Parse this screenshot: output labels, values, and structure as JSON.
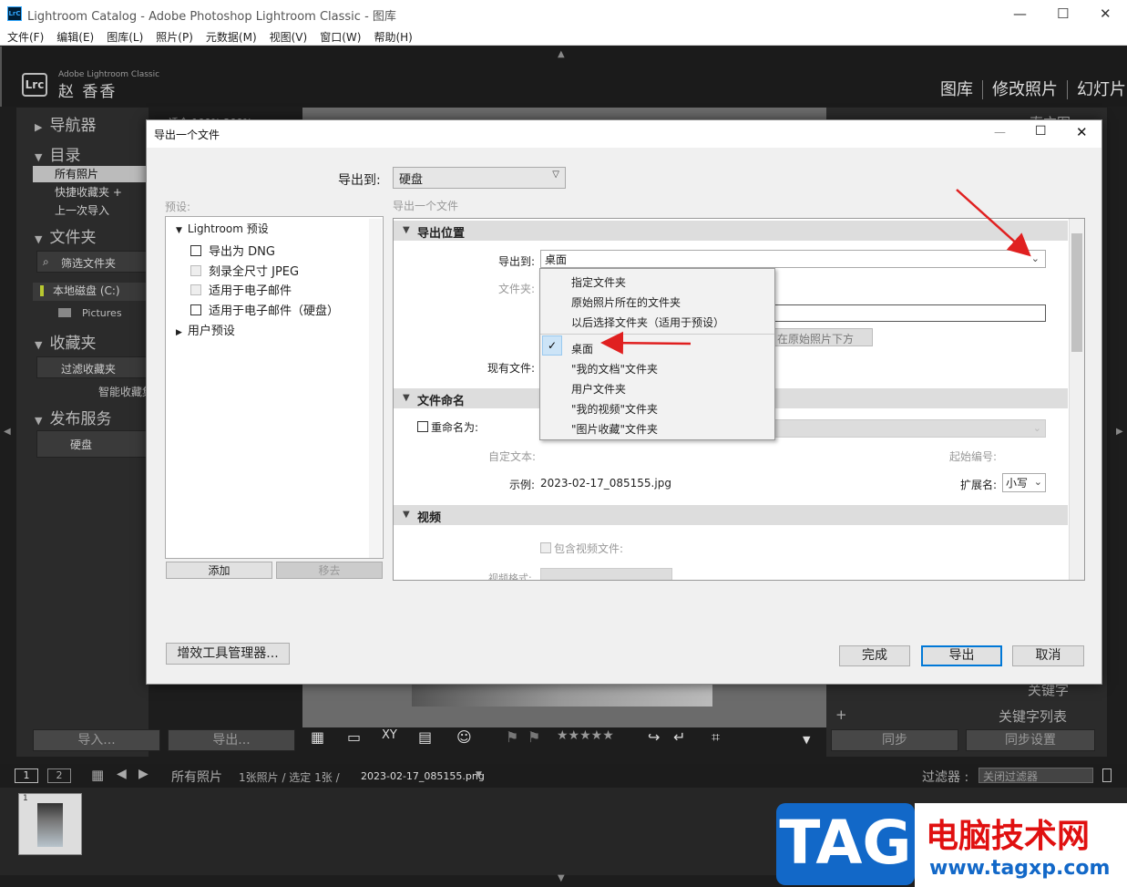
{
  "window": {
    "title": "Lightroom Catalog - Adobe Photoshop Lightroom Classic - 图库",
    "logo": "LrC"
  },
  "menu": [
    "文件(F)",
    "编辑(E)",
    "图库(L)",
    "照片(P)",
    "元数据(M)",
    "视图(V)",
    "窗口(W)",
    "帮助(H)"
  ],
  "lr": {
    "brand": "Adobe Lightroom Classic",
    "user": "赵 香香",
    "logo": "Lrc",
    "modules": [
      "图库",
      "修改照片",
      "幻灯片"
    ],
    "left": {
      "navigator": "导航器",
      "navigator_zoom": "适合  100%  200%",
      "catalog": "目录",
      "catalog_items": [
        "所有照片",
        "快捷收藏夹 +",
        "上一次导入"
      ],
      "folders": "文件夹",
      "filter_folders": "筛选文件夹",
      "disk": "本地磁盘 (C:)",
      "pictures": "Pictures",
      "collections": "收藏夹",
      "filter_collections": "过滤收藏夹",
      "smart_collections": "智能收藏集",
      "publish": "发布服务",
      "hdd": "硬盘"
    },
    "right": {
      "histogram": "直方图",
      "keywords": "关键字",
      "keyword_list": "关键字列表",
      "sync": "同步",
      "sync_settings": "同步设置"
    },
    "import_btn": "导入...",
    "export_btn": "导出...",
    "filmstrip": {
      "page1": "1",
      "page2": "2",
      "source": "所有照片",
      "info": "1张照片 / 选定 1张 /",
      "filename": "2023-02-17_085155.png",
      "filter_label": "过滤器 :",
      "filter_value": "关闭过滤器",
      "thumb_index": "1"
    }
  },
  "dialog": {
    "title": "导出一个文件",
    "export_to_label": "导出到:",
    "export_to_value": "硬盘",
    "presets_label": "预设:",
    "content_label": "导出一个文件",
    "presets": [
      {
        "label": "Lightroom 预设",
        "kind": "group-open"
      },
      {
        "label": "导出为 DNG",
        "kind": "check"
      },
      {
        "label": "刻录全尺寸 JPEG",
        "kind": "check-dis"
      },
      {
        "label": "适用于电子邮件",
        "kind": "check-dis"
      },
      {
        "label": "适用于电子邮件（硬盘）",
        "kind": "check"
      },
      {
        "label": "用户预设",
        "kind": "group-closed"
      }
    ],
    "add_btn": "添加",
    "remove_btn": "移去",
    "plugin_btn": "增效工具管理器...",
    "done_btn": "完成",
    "export_btn": "导出",
    "cancel_btn": "取消",
    "sections": {
      "location": "导出位置",
      "loc_export_to_label": "导出到:",
      "loc_export_to_value": "桌面",
      "folder_label": "文件夹:",
      "subfolder_hint": "在原始照片下方",
      "existing_label": "现有文件:",
      "naming": "文件命名",
      "rename_label": "重命名为:",
      "custom_text": "自定文本:",
      "start_number": "起始编号:",
      "example_label": "示例:",
      "example_value": "2023-02-17_085155.jpg",
      "ext_label": "扩展名:",
      "ext_value": "小写",
      "video": "视频",
      "include_video": "包含视频文件:",
      "video_format": "视频格式:"
    },
    "dropdown": [
      "指定文件夹",
      "原始照片所在的文件夹",
      "以后选择文件夹（适用于预设）",
      "桌面",
      "\"我的文档\"文件夹",
      "用户文件夹",
      "\"我的视频\"文件夹",
      "\"图片收藏\"文件夹"
    ],
    "dropdown_selected": "桌面"
  },
  "watermark": {
    "tag": "TAG",
    "cn": "电脑技术网",
    "url": "www.tagxp.com"
  },
  "colors": {
    "annotation_arrow": "#e02020",
    "watermark_blue": "#1268c8",
    "watermark_red": "#e01010"
  }
}
